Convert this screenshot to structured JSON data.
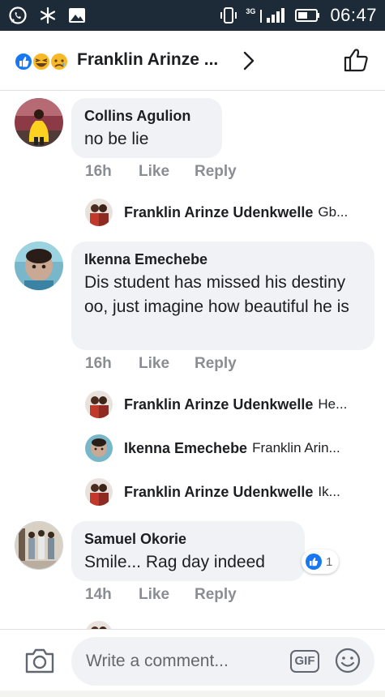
{
  "status_bar": {
    "time": "06:47",
    "network": "3G"
  },
  "header": {
    "title": "Franklin Arinze ...",
    "reactions": [
      "like",
      "haha",
      "sad"
    ]
  },
  "comments": [
    {
      "author": "Collins Agulion",
      "text": "no be lie",
      "time": "16h",
      "like_label": "Like",
      "reply_label": "Reply"
    },
    {
      "author": "Ikenna Emechebe",
      "text": "Dis student has missed his destiny oo, just imagine how beautiful he is",
      "time": "16h",
      "like_label": "Like",
      "reply_label": "Reply"
    },
    {
      "author": "Samuel Okorie",
      "text": "Smile... Rag day indeed",
      "time": "14h",
      "like_label": "Like",
      "reply_label": "Reply",
      "like_count": "1"
    }
  ],
  "replies": [
    {
      "author": "Franklin Arinze Udenkwelle",
      "text": "Gb..."
    },
    {
      "author": "Franklin Arinze Udenkwelle",
      "text": "He..."
    },
    {
      "author": "Ikenna Emechebe",
      "text": "Franklin Arin..."
    },
    {
      "author": "Franklin Arinze Udenkwelle",
      "text": "Ik..."
    }
  ],
  "footer": {
    "placeholder": "Write a comment...",
    "gif_label": "GIF"
  },
  "colors": {
    "status_bar": "#1d2a38",
    "bubble": "#f0f2f5",
    "meta_gray": "#8a8d91",
    "like_blue": "#1877f2"
  }
}
